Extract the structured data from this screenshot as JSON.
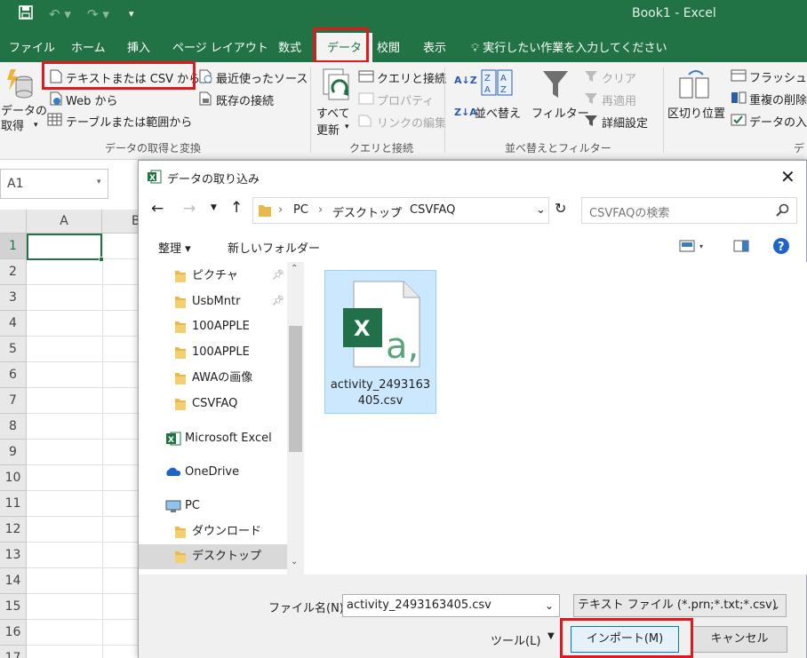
{
  "window": {
    "title": "Book1  -  Excel"
  },
  "tabs": [
    "ファイル",
    "ホーム",
    "挿入",
    "ページ レイアウト",
    "数式",
    "データ",
    "校閲",
    "表示"
  ],
  "tell_me": "実行したい作業を入力してください",
  "ribbon": {
    "get_data": "データの\n取得",
    "from_text_csv": "テキストまたは CSV から",
    "from_web": "Web から",
    "from_table": "テーブルまたは範囲から",
    "recent_sources": "最近使ったソース",
    "existing_connections": "既存の接続",
    "group_get_transform": "データの取得と変換",
    "refresh_all": "すべて\n更新",
    "queries_connections": "クエリと接続",
    "properties": "プロパティ",
    "edit_links": "リンクの編集",
    "group_queries": "クエリと接続",
    "sort_az": "A↓Z",
    "sort_za": "Z↓A",
    "sort": "並べ替え",
    "filter": "フィルター",
    "clear": "クリア",
    "reapply": "再適用",
    "advanced": "詳細設定",
    "group_sort_filter": "並べ替えとフィルター",
    "text_to_columns": "区切り位置",
    "flash_fill": "フラッシュ フ",
    "remove_duplicates": "重複の削除",
    "data_validation": "データの入力",
    "group_data_tools": "デ"
  },
  "name_box": "A1",
  "sheet": {
    "columns": [
      "A",
      "B"
    ],
    "rows": [
      "1",
      "2",
      "3",
      "4",
      "5",
      "6",
      "7",
      "8",
      "9",
      "10",
      "11",
      "12",
      "13",
      "14",
      "15",
      "16",
      "17"
    ]
  },
  "dialog": {
    "title": "データの取り込み",
    "breadcrumb": [
      "PC",
      "デスクトップ",
      "CSVFAQ"
    ],
    "search_placeholder": "CSVFAQの検索",
    "organize": "整理 ▾",
    "new_folder": "新しいフォルダー",
    "nav_items": [
      {
        "label": "ピクチャ",
        "pinned": true
      },
      {
        "label": "UsbMntr",
        "pinned": true
      },
      {
        "label": "100APPLE",
        "pinned": false
      },
      {
        "label": "100APPLE",
        "pinned": false
      },
      {
        "label": "AWAの画像",
        "pinned": false
      },
      {
        "label": "CSVFAQ",
        "pinned": false
      },
      {
        "label": "Microsoft Excel",
        "pinned": false
      },
      {
        "label": "OneDrive",
        "pinned": false
      },
      {
        "label": "PC",
        "pinned": false
      },
      {
        "label": "ダウンロード",
        "pinned": false
      },
      {
        "label": "デスクトップ",
        "pinned": false
      }
    ],
    "file": {
      "name_line1": "activity_2493163",
      "name_line2": "405.csv"
    },
    "filename_label": "ファイル名(N):",
    "filename_value": "activity_2493163405.csv",
    "filetype_value": "テキスト ファイル (*.prn;*.txt;*.csv)",
    "tools": "ツール(L)",
    "import_button": "インポート(M)",
    "cancel_button": "キャンセル"
  },
  "colors": {
    "excel_green": "#217346",
    "highlight_red": "#e0191f",
    "selection_blue": "#cce8ff",
    "folder_yellow": "#e8b84a"
  }
}
